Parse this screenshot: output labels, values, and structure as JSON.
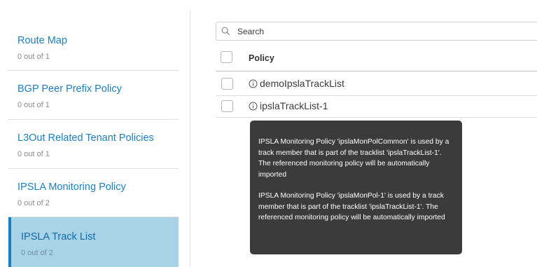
{
  "sidebar": {
    "items": [
      {
        "label": "Route Map",
        "count": "0 out of 1"
      },
      {
        "label": "BGP Peer Prefix Policy",
        "count": "0 out of 1"
      },
      {
        "label": "L3Out Related Tenant Policies",
        "count": "0 out of 1"
      },
      {
        "label": "IPSLA Monitoring Policy",
        "count": "0 out of 2"
      },
      {
        "label": "IPSLA Track List",
        "count": "0 out of 2"
      }
    ],
    "active_index": 4
  },
  "search": {
    "placeholder": "Search"
  },
  "table": {
    "column_header": "Policy",
    "rows": [
      {
        "name": "demoIpslaTrackList"
      },
      {
        "name": "ipslaTrackList-1"
      }
    ]
  },
  "tooltip": {
    "paragraphs": [
      "IPSLA Monitoring Policy 'ipslaMonPolCommon' is used by a track member that is part of the tracklist 'ipslaTrackList-1'. The referenced monitoring policy will be automatically imported",
      "IPSLA Monitoring Policy 'ipslaMonPol-1' is used by a track member that is part of the tracklist 'ipslaTrackList-1'. The referenced monitoring policy will be automatically imported"
    ]
  },
  "colors": {
    "accent": "#1d7fbf",
    "active_bg": "#a8d3e6",
    "tooltip_bg": "#3b3b3b"
  }
}
